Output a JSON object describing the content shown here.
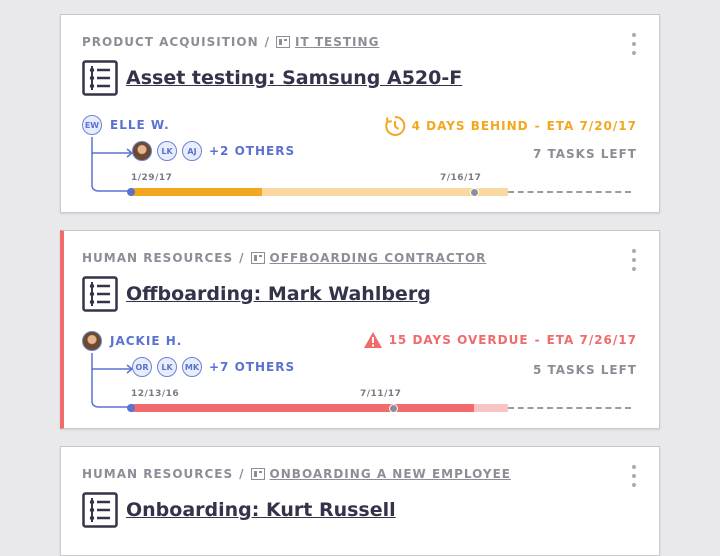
{
  "cards": [
    {
      "category": "PRODUCT ACQUISITION",
      "separator": "/",
      "project": "IT TESTING",
      "title": "Asset testing: Samsung A520-F",
      "owner": {
        "initials": "EW",
        "name": "ELLE W."
      },
      "collaborators": [
        "LK",
        "AJ"
      ],
      "others": "+2 OTHERS",
      "status": {
        "text": "4 DAYS BEHIND",
        "dash": "-",
        "eta": "ETA 7/20/17",
        "icon": "clock-icon",
        "color": "#f2a71e"
      },
      "tasks_left": "7 TASKS LEFT",
      "start_date": "1/29/17",
      "mid_date": "7/16/17",
      "progress": {
        "done": 0.34,
        "today": 0.89,
        "eta_end": 0.98
      }
    },
    {
      "category": "HUMAN RESOURCES",
      "separator": "/",
      "project": "OFFBOARDING CONTRACTOR",
      "title": "Offboarding: Mark Wahlberg",
      "owner": {
        "initials": "",
        "name": "JACKIE H."
      },
      "collaborators": [
        "OR",
        "LK",
        "MK"
      ],
      "others": "+7 OTHERS",
      "status": {
        "text": "15 DAYS OVERDUE",
        "dash": "-",
        "eta": "ETA 7/26/17",
        "icon": "warning-icon",
        "color": "#f06b6b"
      },
      "tasks_left": "5 TASKS LEFT",
      "start_date": "12/13/16",
      "mid_date": "7/11/17",
      "progress": {
        "done": 0.89,
        "today": 0.68,
        "eta_end": 0.98
      }
    },
    {
      "category": "HUMAN RESOURCES",
      "separator": "/",
      "project": "ONBOARDING A NEW EMPLOYEE",
      "title": "Onboarding: Kurt Russell"
    }
  ],
  "colors": {
    "accent_blue": "#5a72d0",
    "behind_orange": "#f2a71e",
    "behind_orange_light": "#f9d9a0",
    "overdue_red": "#f06b6b",
    "overdue_red_light": "#f8c4c4",
    "text_dark": "#33334a",
    "text_muted": "#8d8d97"
  }
}
